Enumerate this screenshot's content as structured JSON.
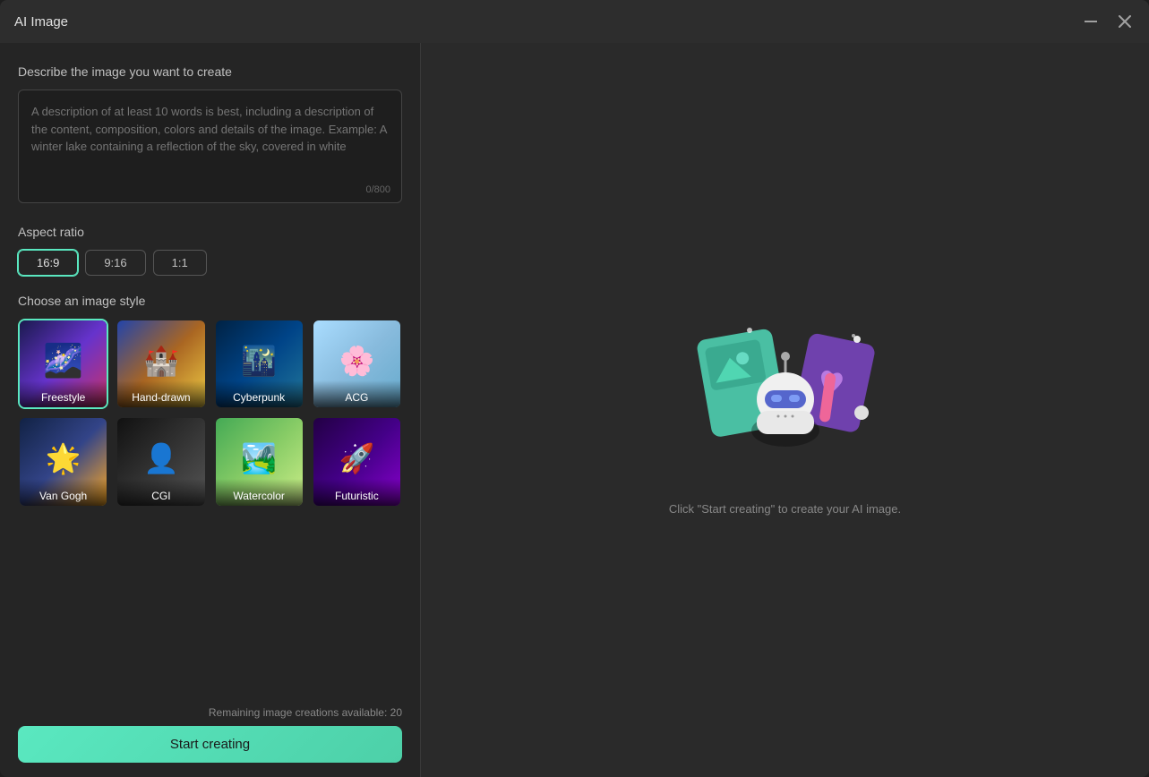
{
  "window": {
    "title": "AI Image",
    "minimize_label": "minimize",
    "close_label": "close"
  },
  "left": {
    "describe_label": "Describe the image you want to create",
    "textarea_placeholder": "A description of at least 10 words is best, including a description of the content, composition, colors and details of the image. Example: A winter lake containing a reflection of the sky, covered in white",
    "textarea_value": "",
    "char_count": "0/800",
    "aspect_ratio_label": "Aspect ratio",
    "aspect_options": [
      {
        "label": "16:9",
        "active": true
      },
      {
        "label": "9:16",
        "active": false
      },
      {
        "label": "1:1",
        "active": false
      }
    ],
    "style_label": "Choose an image style",
    "styles": [
      {
        "key": "freestyle",
        "label": "Freestyle",
        "active": true,
        "bg_class": "bg-freestyle"
      },
      {
        "key": "handdrawn",
        "label": "Hand-drawn",
        "active": false,
        "bg_class": "bg-handdrawn"
      },
      {
        "key": "cyberpunk",
        "label": "Cyberpunk",
        "active": false,
        "bg_class": "bg-cyberpunk"
      },
      {
        "key": "acg",
        "label": "ACG",
        "active": false,
        "bg_class": "bg-acg"
      },
      {
        "key": "vangogh",
        "label": "Van Gogh",
        "active": false,
        "bg_class": "bg-vangogh"
      },
      {
        "key": "cgi",
        "label": "CGI",
        "active": false,
        "bg_class": "bg-cgi"
      },
      {
        "key": "watercolor",
        "label": "Watercolor",
        "active": false,
        "bg_class": "bg-watercolor"
      },
      {
        "key": "futuristic",
        "label": "Futuristic",
        "active": false,
        "bg_class": "bg-futuristic"
      }
    ],
    "remaining_text": "Remaining image creations available: 20",
    "start_button_label": "Start creating"
  },
  "right": {
    "placeholder_text": "Click \"Start creating\" to create your AI image."
  }
}
